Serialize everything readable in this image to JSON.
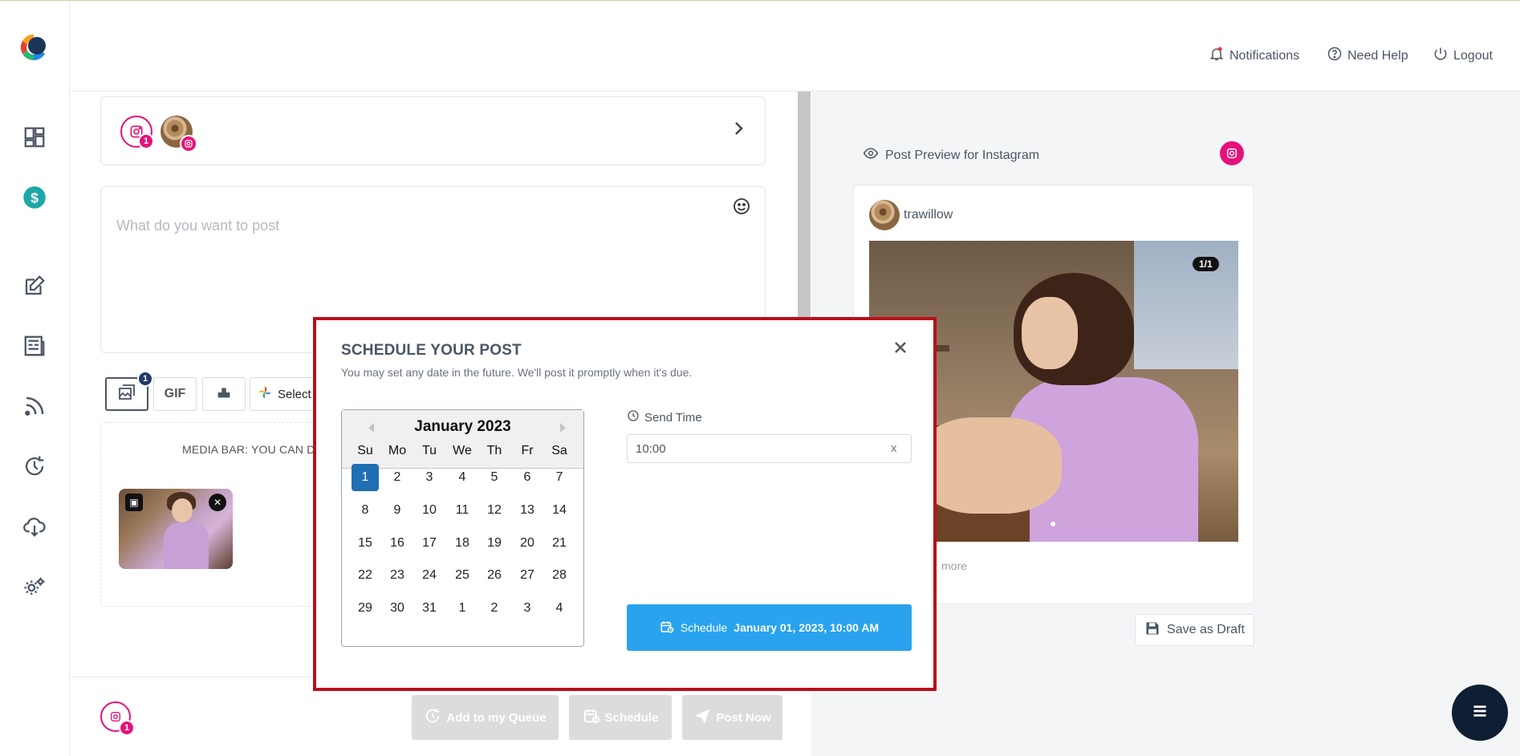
{
  "header": {
    "notifications_label": "Notifications",
    "help_label": "Need Help",
    "logout_label": "Logout"
  },
  "sidebar": {
    "items": [
      {
        "icon": "dashboard-icon"
      },
      {
        "icon": "billing-icon"
      },
      {
        "icon": "compose-icon"
      },
      {
        "icon": "posts-icon"
      },
      {
        "icon": "rss-icon"
      },
      {
        "icon": "recycle-icon"
      },
      {
        "icon": "cloud-download-icon"
      },
      {
        "icon": "settings-icon"
      }
    ]
  },
  "editor": {
    "account_badge_count": "1",
    "compose_placeholder": "What do you want to post",
    "media_badge_count": "1",
    "gif_label": "GIF",
    "select_label": "Select f",
    "mediabar_text": "MEDIA BAR: YOU CAN DR"
  },
  "bottom_bar": {
    "badge_count": "1",
    "add_queue_label": "Add to my Queue",
    "schedule_label": "Schedule",
    "post_now_label": "Post Now"
  },
  "preview": {
    "title": "Post Preview for Instagram",
    "username": "trawillow",
    "counter": "1/1",
    "more_label": "more",
    "save_draft_label": "Save as Draft"
  },
  "modal": {
    "title": "SCHEDULE YOUR POST",
    "subtitle": "You may set any date in the future. We'll post it promptly when it's due.",
    "calendar": {
      "month_label": "January 2023",
      "weekdays": [
        "Su",
        "Mo",
        "Tu",
        "We",
        "Th",
        "Fr",
        "Sa"
      ],
      "weeks": [
        [
          "1",
          "2",
          "3",
          "4",
          "5",
          "6",
          "7"
        ],
        [
          "8",
          "9",
          "10",
          "11",
          "12",
          "13",
          "14"
        ],
        [
          "15",
          "16",
          "17",
          "18",
          "19",
          "20",
          "21"
        ],
        [
          "22",
          "23",
          "24",
          "25",
          "26",
          "27",
          "28"
        ],
        [
          "29",
          "30",
          "31",
          "1",
          "2",
          "3",
          "4"
        ]
      ],
      "selected": "1"
    },
    "send_time_label": "Send Time",
    "send_time_value": "10:00",
    "clear_label": "x",
    "schedule_button_label": "Schedule",
    "schedule_button_date": "January 01, 2023, 10:00 AM"
  },
  "colors": {
    "instagram": "#e4127a",
    "accent_blue": "#2aa3ee",
    "modal_border": "#b80f1a",
    "selected_day": "#1f6fb2"
  }
}
